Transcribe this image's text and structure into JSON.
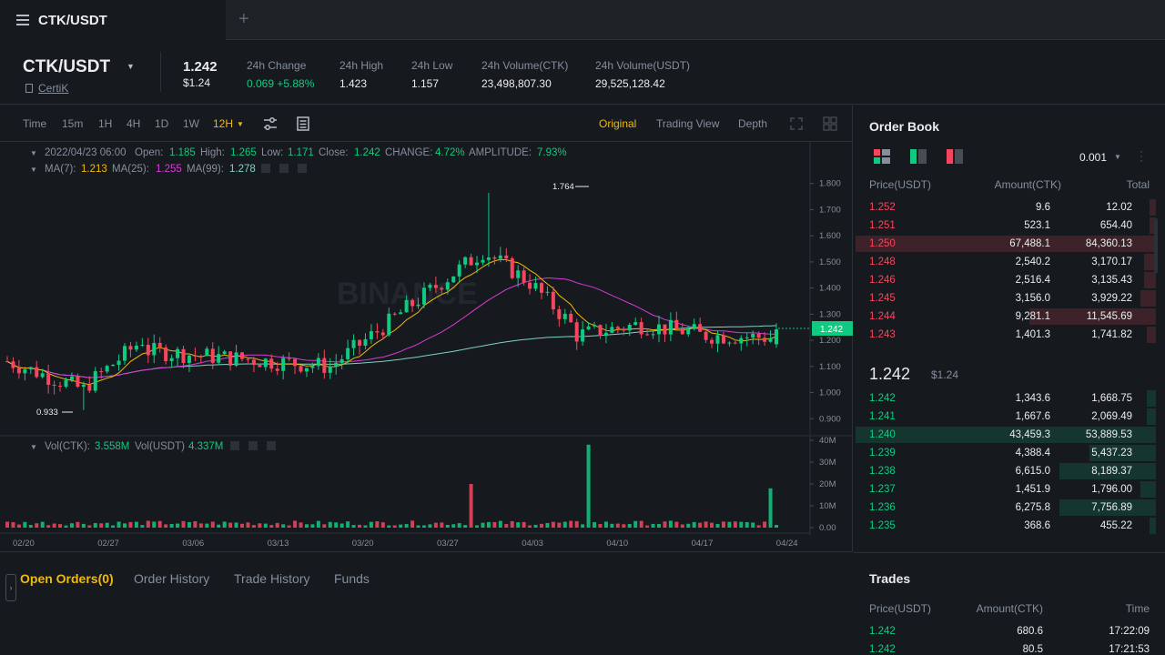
{
  "tab": {
    "title": "CTK/USDT",
    "new_tab": "+"
  },
  "header": {
    "pair": "CTK/USDT",
    "project": "CertiK",
    "price": "1.242",
    "price_usd": "$1.24",
    "stats": [
      {
        "label": "24h Change",
        "value": "0.069 +5.88%",
        "color": "green"
      },
      {
        "label": "24h High",
        "value": "1.423",
        "color": "white"
      },
      {
        "label": "24h Low",
        "value": "1.157",
        "color": "white"
      },
      {
        "label": "24h Volume(CTK)",
        "value": "23,498,807.30",
        "color": "white"
      },
      {
        "label": "24h Volume(USDT)",
        "value": "29,525,128.42",
        "color": "white"
      }
    ]
  },
  "toolbar": {
    "intervals": [
      "Time",
      "15m",
      "1H",
      "4H",
      "1D",
      "1W",
      "12H"
    ],
    "active_interval": "12H",
    "views": [
      "Original",
      "Trading View",
      "Depth"
    ],
    "active_view": "Original"
  },
  "chart_info": {
    "date": "2022/04/23 06:00",
    "open_label": "Open:",
    "open": "1.185",
    "high_label": "High:",
    "high": "1.265",
    "low_label": "Low:",
    "low": "1.171",
    "close_label": "Close:",
    "close": "1.242",
    "change_label": "CHANGE:",
    "change": "4.72%",
    "amplitude_label": "AMPLITUDE:",
    "amplitude": "7.93%",
    "ma7_label": "MA(7):",
    "ma7": "1.213",
    "ma25_label": "MA(25):",
    "ma25": "1.255",
    "ma99_label": "MA(99):",
    "ma99": "1.278",
    "vol_ctk_label": "Vol(CTK):",
    "vol_ctk": "3.558M",
    "vol_usdt_label": "Vol(USDT)",
    "vol_usdt": "4.337M",
    "max_marker": "1.764",
    "min_marker": "0.933",
    "current_price_tag": "1.242",
    "watermark": "BINANCE"
  },
  "chart_data": {
    "type": "candlestick",
    "price_axis": [
      "1.800",
      "1.700",
      "1.600",
      "1.500",
      "1.400",
      "1.300",
      "1.200",
      "1.100",
      "1.000",
      "0.900"
    ],
    "price_ylim": [
      0.88,
      1.82
    ],
    "volume_axis": [
      "40M",
      "30M",
      "20M",
      "10M",
      "0.00"
    ],
    "volume_ylim": [
      0,
      40
    ],
    "x_labels": [
      "02/20",
      "02/27",
      "03/06",
      "03/13",
      "03/20",
      "03/27",
      "04/03",
      "04/10",
      "04/17",
      "04/24"
    ],
    "ma_colors": {
      "ma7": "#f0b90b",
      "ma25": "#d63bd6",
      "ma99": "#7fd1c4"
    },
    "up_color": "#0ecb81",
    "down_color": "#f6465d"
  },
  "bottom_tabs": [
    {
      "label": "Open Orders(0)",
      "active": true
    },
    {
      "label": "Order History",
      "active": false
    },
    {
      "label": "Trade History",
      "active": false
    },
    {
      "label": "Funds",
      "active": false
    }
  ],
  "order_book": {
    "title": "Order Book",
    "precision": "0.001",
    "headers": [
      "Price(USDT)",
      "Amount(CTK)",
      "Total"
    ],
    "asks": [
      {
        "price": "1.252",
        "amount": "9.6",
        "total": "12.02",
        "depth": 0.02
      },
      {
        "price": "1.251",
        "amount": "523.1",
        "total": "654.40",
        "depth": 0.02
      },
      {
        "price": "1.250",
        "amount": "67,488.1",
        "total": "84,360.13",
        "depth": 1.0
      },
      {
        "price": "1.248",
        "amount": "2,540.2",
        "total": "3,170.17",
        "depth": 0.04
      },
      {
        "price": "1.246",
        "amount": "2,516.4",
        "total": "3,135.43",
        "depth": 0.04
      },
      {
        "price": "1.245",
        "amount": "3,156.0",
        "total": "3,929.22",
        "depth": 0.05
      },
      {
        "price": "1.244",
        "amount": "9,281.1",
        "total": "11,545.69",
        "depth": 0.42
      },
      {
        "price": "1.243",
        "amount": "1,401.3",
        "total": "1,741.82",
        "depth": 0.03
      }
    ],
    "last_price": "1.242",
    "last_price_usd": "$1.24",
    "bids": [
      {
        "price": "1.242",
        "amount": "1,343.6",
        "total": "1,668.75",
        "depth": 0.03
      },
      {
        "price": "1.241",
        "amount": "1,667.6",
        "total": "2,069.49",
        "depth": 0.03
      },
      {
        "price": "1.240",
        "amount": "43,459.3",
        "total": "53,889.53",
        "depth": 1.0
      },
      {
        "price": "1.239",
        "amount": "4,388.4",
        "total": "5,437.23",
        "depth": 0.22
      },
      {
        "price": "1.238",
        "amount": "6,615.0",
        "total": "8,189.37",
        "depth": 0.32
      },
      {
        "price": "1.237",
        "amount": "1,451.9",
        "total": "1,796.00",
        "depth": 0.05
      },
      {
        "price": "1.236",
        "amount": "6,275.8",
        "total": "7,756.89",
        "depth": 0.32
      },
      {
        "price": "1.235",
        "amount": "368.6",
        "total": "455.22",
        "depth": 0.02
      }
    ]
  },
  "trades": {
    "title": "Trades",
    "headers": [
      "Price(USDT)",
      "Amount(CTK)",
      "Time"
    ],
    "rows": [
      {
        "price": "1.242",
        "amount": "680.6",
        "time": "17:22:09"
      },
      {
        "price": "1.242",
        "amount": "80.5",
        "time": "17:21:53"
      }
    ]
  }
}
